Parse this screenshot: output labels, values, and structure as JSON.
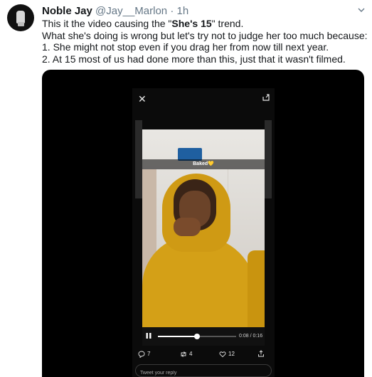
{
  "tweet": {
    "author_name": "Noble Jay",
    "author_handle": "@Jay__Marlon",
    "separator": "·",
    "time": "1h",
    "lines": {
      "line1_pre": "This it the video causing the \"",
      "line1_bold": "She's 15",
      "line1_post": "\" trend.",
      "line2": "What she's doing is wrong but let's try not to judge her too much because:",
      "line3": "1. She might not stop even if you drag her from now till next year.",
      "line4": "2. At 15 most of us had done more than this, just that it wasn't filmed."
    }
  },
  "video": {
    "caption": "Baked💛",
    "timecode": "0:08 / 0:16",
    "progress": 0.5,
    "stats": {
      "replies": "7",
      "retweets": "4",
      "likes": "12"
    },
    "reply_placeholder": "Tweet your reply"
  },
  "icons": {
    "avatar": "avatar-hand-icon",
    "more": "chevron-down-icon",
    "close": "close-icon",
    "expand": "expand-icon",
    "pause": "pause-icon",
    "reply": "reply-icon",
    "retweet": "retweet-icon",
    "like": "heart-icon",
    "share": "share-icon"
  },
  "colors": {
    "text": "#14171a",
    "muted": "#657786",
    "video_bg": "#000000",
    "hoodie": "#d4a017"
  }
}
